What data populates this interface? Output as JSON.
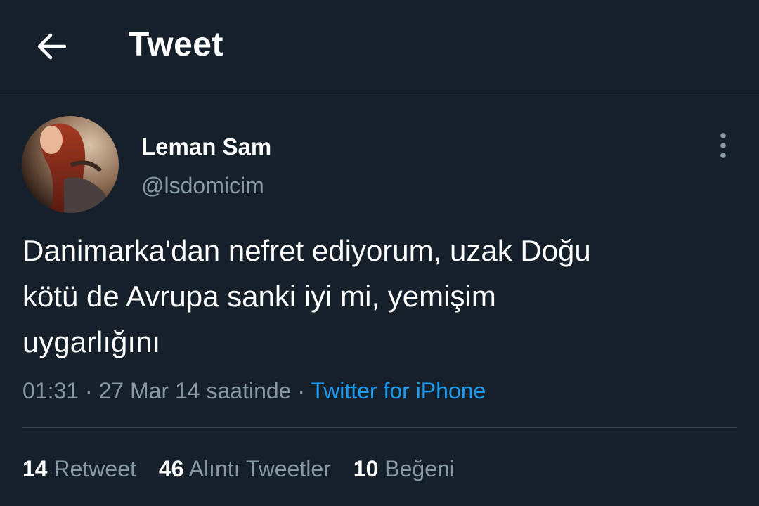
{
  "header": {
    "back_icon": "arrow-left-icon",
    "title": "Tweet"
  },
  "author": {
    "display_name": "Leman Sam",
    "handle": "@lsdomicim",
    "avatar_icon": "profile-avatar",
    "more_icon": "more-vertical-icon"
  },
  "tweet": {
    "text": "Danimarka'dan nefret ediyorum, uzak Doğu\nkötü de Avrupa sanki iyi mi, yemişim\nuygarlığını",
    "time": "01:31",
    "separator": "·",
    "date": "27 Mar 14 saatinde",
    "source": "Twitter for iPhone"
  },
  "stats": {
    "retweets": {
      "count": "14",
      "label": "Retweet"
    },
    "quotes": {
      "count": "46",
      "label": "Alıntı Tweetler"
    },
    "likes": {
      "count": "10",
      "label": "Beğeni"
    }
  },
  "colors": {
    "background": "#15202b",
    "text_primary": "#ffffff",
    "text_secondary": "#8899a6",
    "link": "#1d9bf0",
    "divider": "#38444d"
  }
}
